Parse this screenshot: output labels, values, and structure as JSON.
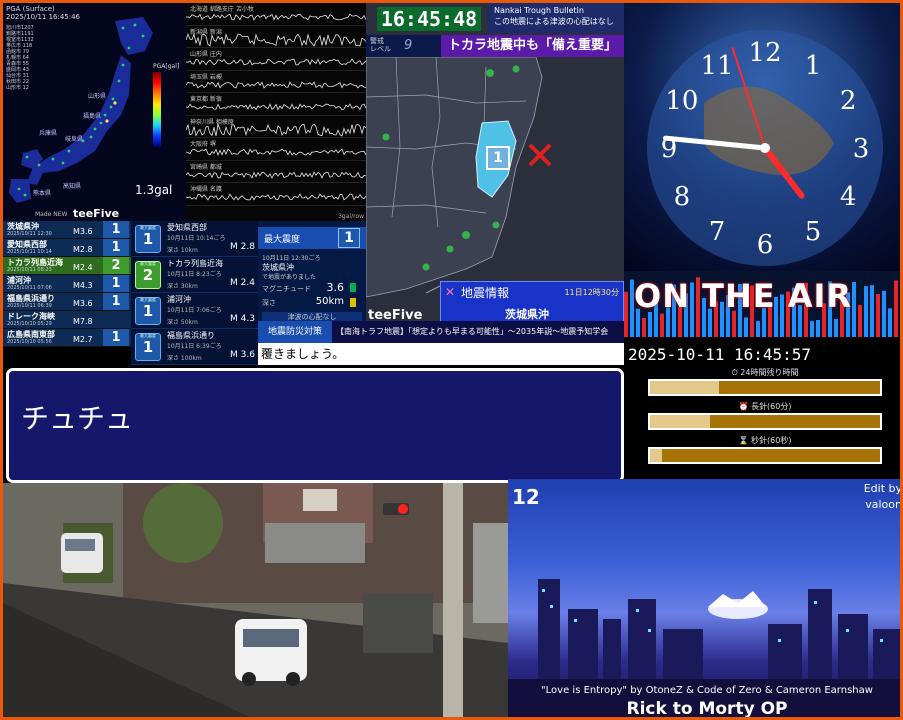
{
  "shindo_map": {
    "header_line1": "PGA (Surface)",
    "header_line2": "2025/10/11 16:45:46",
    "stations": [
      "旭川市1207",
      "釧路市1191",
      "根室市1132",
      "帯広市 118",
      "函館市 79",
      "札幌市 64",
      "青森市 55",
      "盛岡市 43",
      "仙台市 31",
      "秋田市 22",
      "山形市 12"
    ],
    "pga_label": "PGA[gal]",
    "pga_ticks": [
      "1000",
      "500",
      "200",
      "100",
      "50",
      "20",
      "10",
      "5",
      "2",
      "1",
      "0.5",
      "0.2"
    ],
    "gal_value": "1.3gal",
    "brand": "teeFive",
    "brand_small": "Made NEW"
  },
  "waveforms": {
    "stations": [
      "北海道 釧路支庁 苫小牧",
      "新潟県 新潟",
      "山形県 庄内",
      "埼玉県 岩槻",
      "東京都 新宿",
      "神奈川県 相模原",
      "大阪府 堺",
      "宮崎県 都城",
      "沖縄県 名護"
    ],
    "scale": "3gal/row"
  },
  "quake_map": {
    "clock": "16:45:48",
    "tsunami_line1": "Nankai Trough Bulletin",
    "tsunami_line2": "この地震による津波の心配はなし",
    "level_label": "警戒\nレベル",
    "level_value": "9",
    "headline": "トカラ地震中も「備え重要」",
    "region_intensity": "1",
    "info_title": "地震情報",
    "info_time": "11日12時30分",
    "info_location": "茨城県沖",
    "brand": "teeFive"
  },
  "history": [
    {
      "region": "茨城県沖",
      "date": "2025/10/11 12:30",
      "mag": "M3.6",
      "intensity": "1",
      "highlight": false
    },
    {
      "region": "愛知県西部",
      "date": "2025/10/11 10:14",
      "mag": "M2.8",
      "intensity": "1",
      "highlight": false
    },
    {
      "region": "トカラ列島近海",
      "date": "2025/10/11 08:23",
      "mag": "M2.4",
      "intensity": "2",
      "highlight": true
    },
    {
      "region": "浦河沖",
      "date": "2025/10/11 07:06",
      "mag": "M4.3",
      "intensity": "1",
      "highlight": false
    },
    {
      "region": "福島県浜通り",
      "date": "2025/10/11 06:39",
      "mag": "M3.6",
      "intensity": "1",
      "highlight": false
    },
    {
      "region": "ドレーク海峡",
      "date": "2025/10/10 05:29",
      "mag": "M7.8",
      "intensity": "",
      "highlight": false
    },
    {
      "region": "広島県南東部",
      "date": "2025/10/10 05:56",
      "mag": "M2.7",
      "intensity": "1",
      "highlight": false
    }
  ],
  "details": [
    {
      "region": "愛知県西部",
      "date": "10月11日 10:14ごろ",
      "depth": "深さ 10km",
      "mag": "M 2.8",
      "intensity": "1",
      "level": "s1"
    },
    {
      "region": "トカラ列島近海",
      "date": "10月11日 8:23ごろ",
      "depth": "深さ 30km",
      "mag": "M 2.4",
      "intensity": "2",
      "level": "s2"
    },
    {
      "region": "浦河沖",
      "date": "10月11日 7:06ごろ",
      "depth": "深さ 50km",
      "mag": "M 4.3",
      "intensity": "1",
      "level": "s1"
    },
    {
      "region": "福島県浜通り",
      "date": "10月11日 6:39ごろ",
      "depth": "深さ 100km",
      "mag": "M 3.6",
      "intensity": "1",
      "level": "s1"
    }
  ],
  "detail_badge_label": "最大震度",
  "max_box": {
    "label": "最大震度",
    "value": "1",
    "time": "10月11日 12:30ごろ",
    "region": "茨城県沖",
    "note": "で地震がありました",
    "mag_label": "マグニチュード",
    "mag_value": "3.6",
    "depth_label": "深さ",
    "depth_value": "50km",
    "tsunami": "津波の心配なし"
  },
  "ticker": {
    "label": "地震防災対策",
    "text": "【南海トラフ地震】「想定よりも早まる可能性」〜2035年説〜地震予知学会"
  },
  "subline": "覆きましょう。",
  "dialog": "チュチュ",
  "analog_clock": {
    "numerals": [
      "12",
      "1",
      "2",
      "3",
      "4",
      "5",
      "6",
      "7",
      "8",
      "9",
      "10",
      "11"
    ],
    "hour": 16,
    "minute": 45,
    "second": 57
  },
  "onair": "ON THE AIR",
  "countdown": {
    "datetime": "2025-10-11 16:45:57",
    "rows": [
      {
        "label": "⏱ 24時間残り時間",
        "progress": 0.3
      },
      {
        "label": "⏰ 長針(60分)",
        "progress": 0.26
      },
      {
        "label": "⌛ 秒針(60秒)",
        "progress": 0.05
      }
    ]
  },
  "anime": {
    "number": "12",
    "edit_line1": "Edit by",
    "edit_line2": "valoon",
    "credit": "\"Love is Entropy\" by OtoneZ & Code of Zero & Cameron Earnshaw",
    "title": "Rick to Morty OP"
  },
  "colors": {
    "frame": "#e8590c",
    "dialog_bg": "#15176a",
    "headline_bg": "#5a1ca8",
    "clock_green": "#0a6b2c"
  }
}
